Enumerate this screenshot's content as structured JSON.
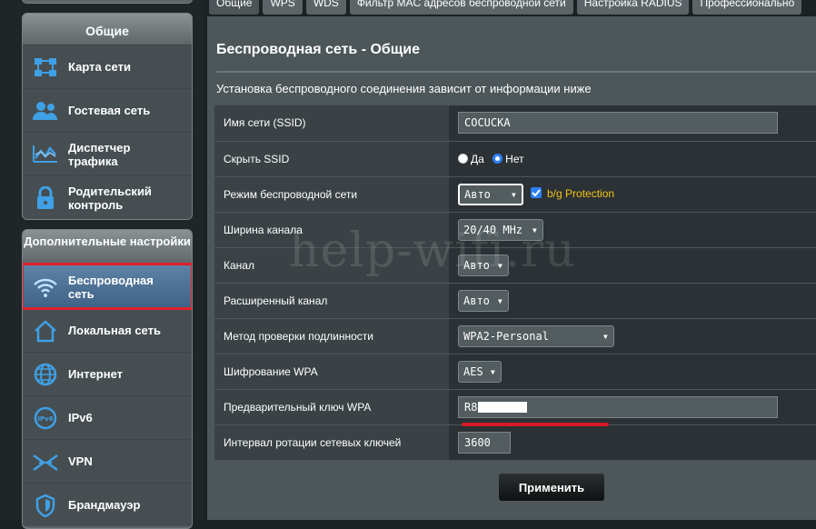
{
  "sidebar": {
    "general": {
      "header": "Общие",
      "items": [
        {
          "label": "Карта сети",
          "icon": "network-map-icon"
        },
        {
          "label": "Гостевая сеть",
          "icon": "guest-network-icon"
        },
        {
          "label": "Диспетчер трафика",
          "icon": "traffic-manager-icon"
        },
        {
          "label": "Родительский контроль",
          "icon": "parental-control-icon"
        }
      ]
    },
    "advanced": {
      "header": "Дополнительные настройки",
      "items": [
        {
          "label": "Беспроводная сеть",
          "icon": "wifi-icon"
        },
        {
          "label": "Локальная сеть",
          "icon": "home-lan-icon"
        },
        {
          "label": "Интернет",
          "icon": "globe-icon"
        },
        {
          "label": "IPv6",
          "icon": "ipv6-icon"
        },
        {
          "label": "VPN",
          "icon": "vpn-icon"
        },
        {
          "label": "Брандмауэр",
          "icon": "firewall-shield-icon"
        }
      ]
    }
  },
  "tabs": [
    "Общие",
    "WPS",
    "WDS",
    "Фильтр MAC адресов беспроводной сети",
    "Настройка RADIUS",
    "Профессионально"
  ],
  "page": {
    "title": "Беспроводная сеть - Общие",
    "description": "Установка беспроводного соединения зависит от информации ниже"
  },
  "form": {
    "ssid": {
      "label": "Имя сети (SSID)",
      "value": "COCUCKA"
    },
    "hide_ssid": {
      "label": "Скрыть SSID",
      "opt_yes": "Да",
      "opt_no": "Нет"
    },
    "mode": {
      "label": "Режим беспроводной сети",
      "value": "Авто",
      "bg_protection": "b/g Protection"
    },
    "width": {
      "label": "Ширина канала",
      "value": "20/40 MHz"
    },
    "channel": {
      "label": "Канал",
      "value": "Авто"
    },
    "ext_channel": {
      "label": "Расширенный канал",
      "value": "Авто"
    },
    "auth": {
      "label": "Метод проверки подлинности",
      "value": "WPA2-Personal"
    },
    "encryption": {
      "label": "Шифрование WPA",
      "value": "AES"
    },
    "psk": {
      "label": "Предварительный ключ WPA",
      "value": "R8"
    },
    "rotation": {
      "label": "Интервал ротации сетевых ключей",
      "value": "3600"
    }
  },
  "apply_label": "Применить",
  "watermark": "help-wifi.ru"
}
